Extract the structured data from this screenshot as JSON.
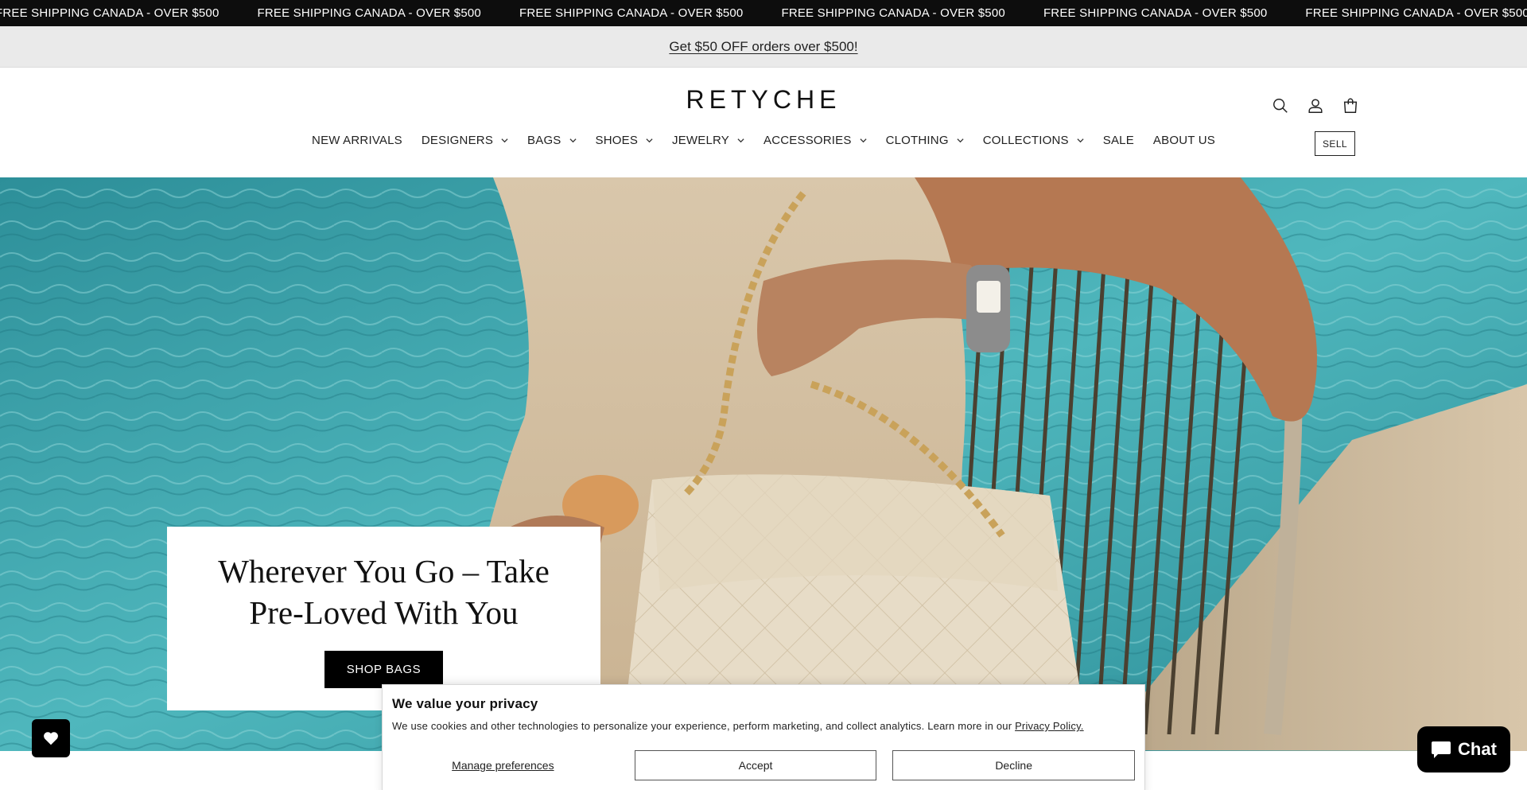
{
  "announcement": {
    "items": [
      "FREE SHIPPING CANADA - OVER $500",
      "FREE SHIPPING CANADA - OVER $500",
      "FREE SHIPPING CANADA - OVER $500",
      "FREE SHIPPING CANADA - OVER $500",
      "FREE SHIPPING CANADA - OVER $500",
      "FREE SHIPPING CANADA - OVER $500"
    ]
  },
  "promo": {
    "link_text": "Get $50 OFF orders over $500!"
  },
  "header": {
    "logo": "RETYCHE",
    "icons": [
      "search-icon",
      "account-icon",
      "cart-icon"
    ],
    "sell_label": "SELL"
  },
  "nav": {
    "items": [
      {
        "label": "NEW ARRIVALS",
        "dropdown": false
      },
      {
        "label": "DESIGNERS",
        "dropdown": true
      },
      {
        "label": "BAGS",
        "dropdown": true
      },
      {
        "label": "SHOES",
        "dropdown": true
      },
      {
        "label": "JEWELRY",
        "dropdown": true
      },
      {
        "label": "ACCESSORIES",
        "dropdown": true
      },
      {
        "label": "CLOTHING",
        "dropdown": true
      },
      {
        "label": "COLLECTIONS",
        "dropdown": true
      },
      {
        "label": "SALE",
        "dropdown": false
      },
      {
        "label": "ABOUT US",
        "dropdown": false
      }
    ]
  },
  "hero": {
    "title": "Wherever You Go – Take Pre-Loved With You",
    "cta_label": "SHOP BAGS"
  },
  "privacy": {
    "title": "We value your privacy",
    "text": "We use cookies and other technologies to personalize your experience, perform marketing, and collect analytics. Learn more in our ",
    "policy_link": "Privacy Policy.",
    "manage_label": "Manage preferences",
    "accept_label": "Accept",
    "decline_label": "Decline"
  },
  "chat": {
    "label": "Chat",
    "icon": "chat-bubble-icon"
  },
  "wishlist": {
    "icon": "heart-icon"
  }
}
